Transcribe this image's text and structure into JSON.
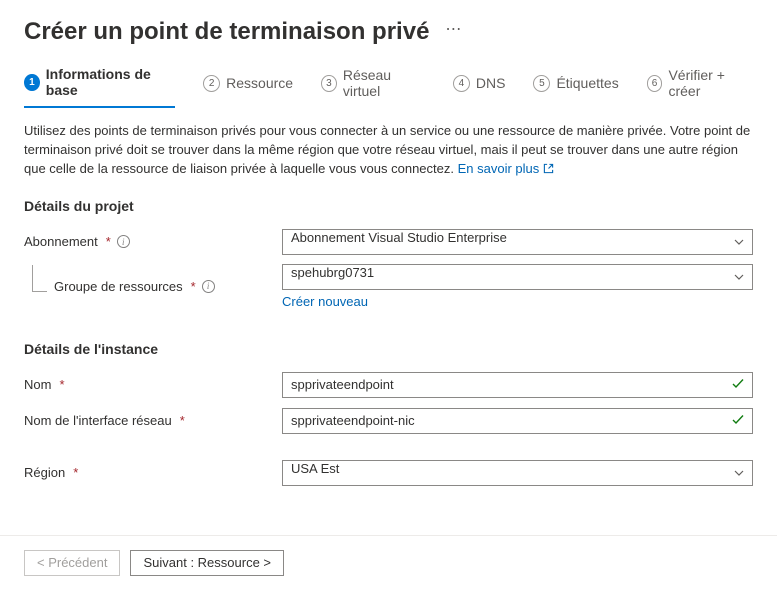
{
  "header": {
    "title": "Créer un point de terminaison privé"
  },
  "tabs": [
    {
      "num": "1",
      "label": "Informations de base"
    },
    {
      "num": "2",
      "label": "Ressource"
    },
    {
      "num": "3",
      "label": "Réseau virtuel"
    },
    {
      "num": "4",
      "label": "DNS"
    },
    {
      "num": "5",
      "label": "Étiquettes"
    },
    {
      "num": "6",
      "label": "Vérifier + créer"
    }
  ],
  "intro": {
    "text": "Utilisez des points de terminaison privés pour vous connecter à un service ou une ressource de manière privée. Votre point de terminaison privé doit se trouver dans la même région que votre réseau virtuel, mais il peut se trouver dans une autre région que celle de la ressource de liaison privée à laquelle vous vous connectez. ",
    "link": "En savoir plus"
  },
  "sections": {
    "project": {
      "title": "Détails du projet",
      "subscription": {
        "label": "Abonnement",
        "value": "Abonnement Visual Studio Enterprise"
      },
      "resourceGroup": {
        "label": "Groupe de ressources",
        "value": "spehubrg0731",
        "createNew": "Créer nouveau"
      }
    },
    "instance": {
      "title": "Détails de l'instance",
      "name": {
        "label": "Nom",
        "value": "spprivateendpoint"
      },
      "nic": {
        "label": "Nom de l'interface réseau",
        "value": "spprivateendpoint-nic"
      },
      "region": {
        "label": "Région",
        "value": "USA Est"
      }
    }
  },
  "footer": {
    "prev": "< Précédent",
    "next": "Suivant : Ressource >"
  }
}
